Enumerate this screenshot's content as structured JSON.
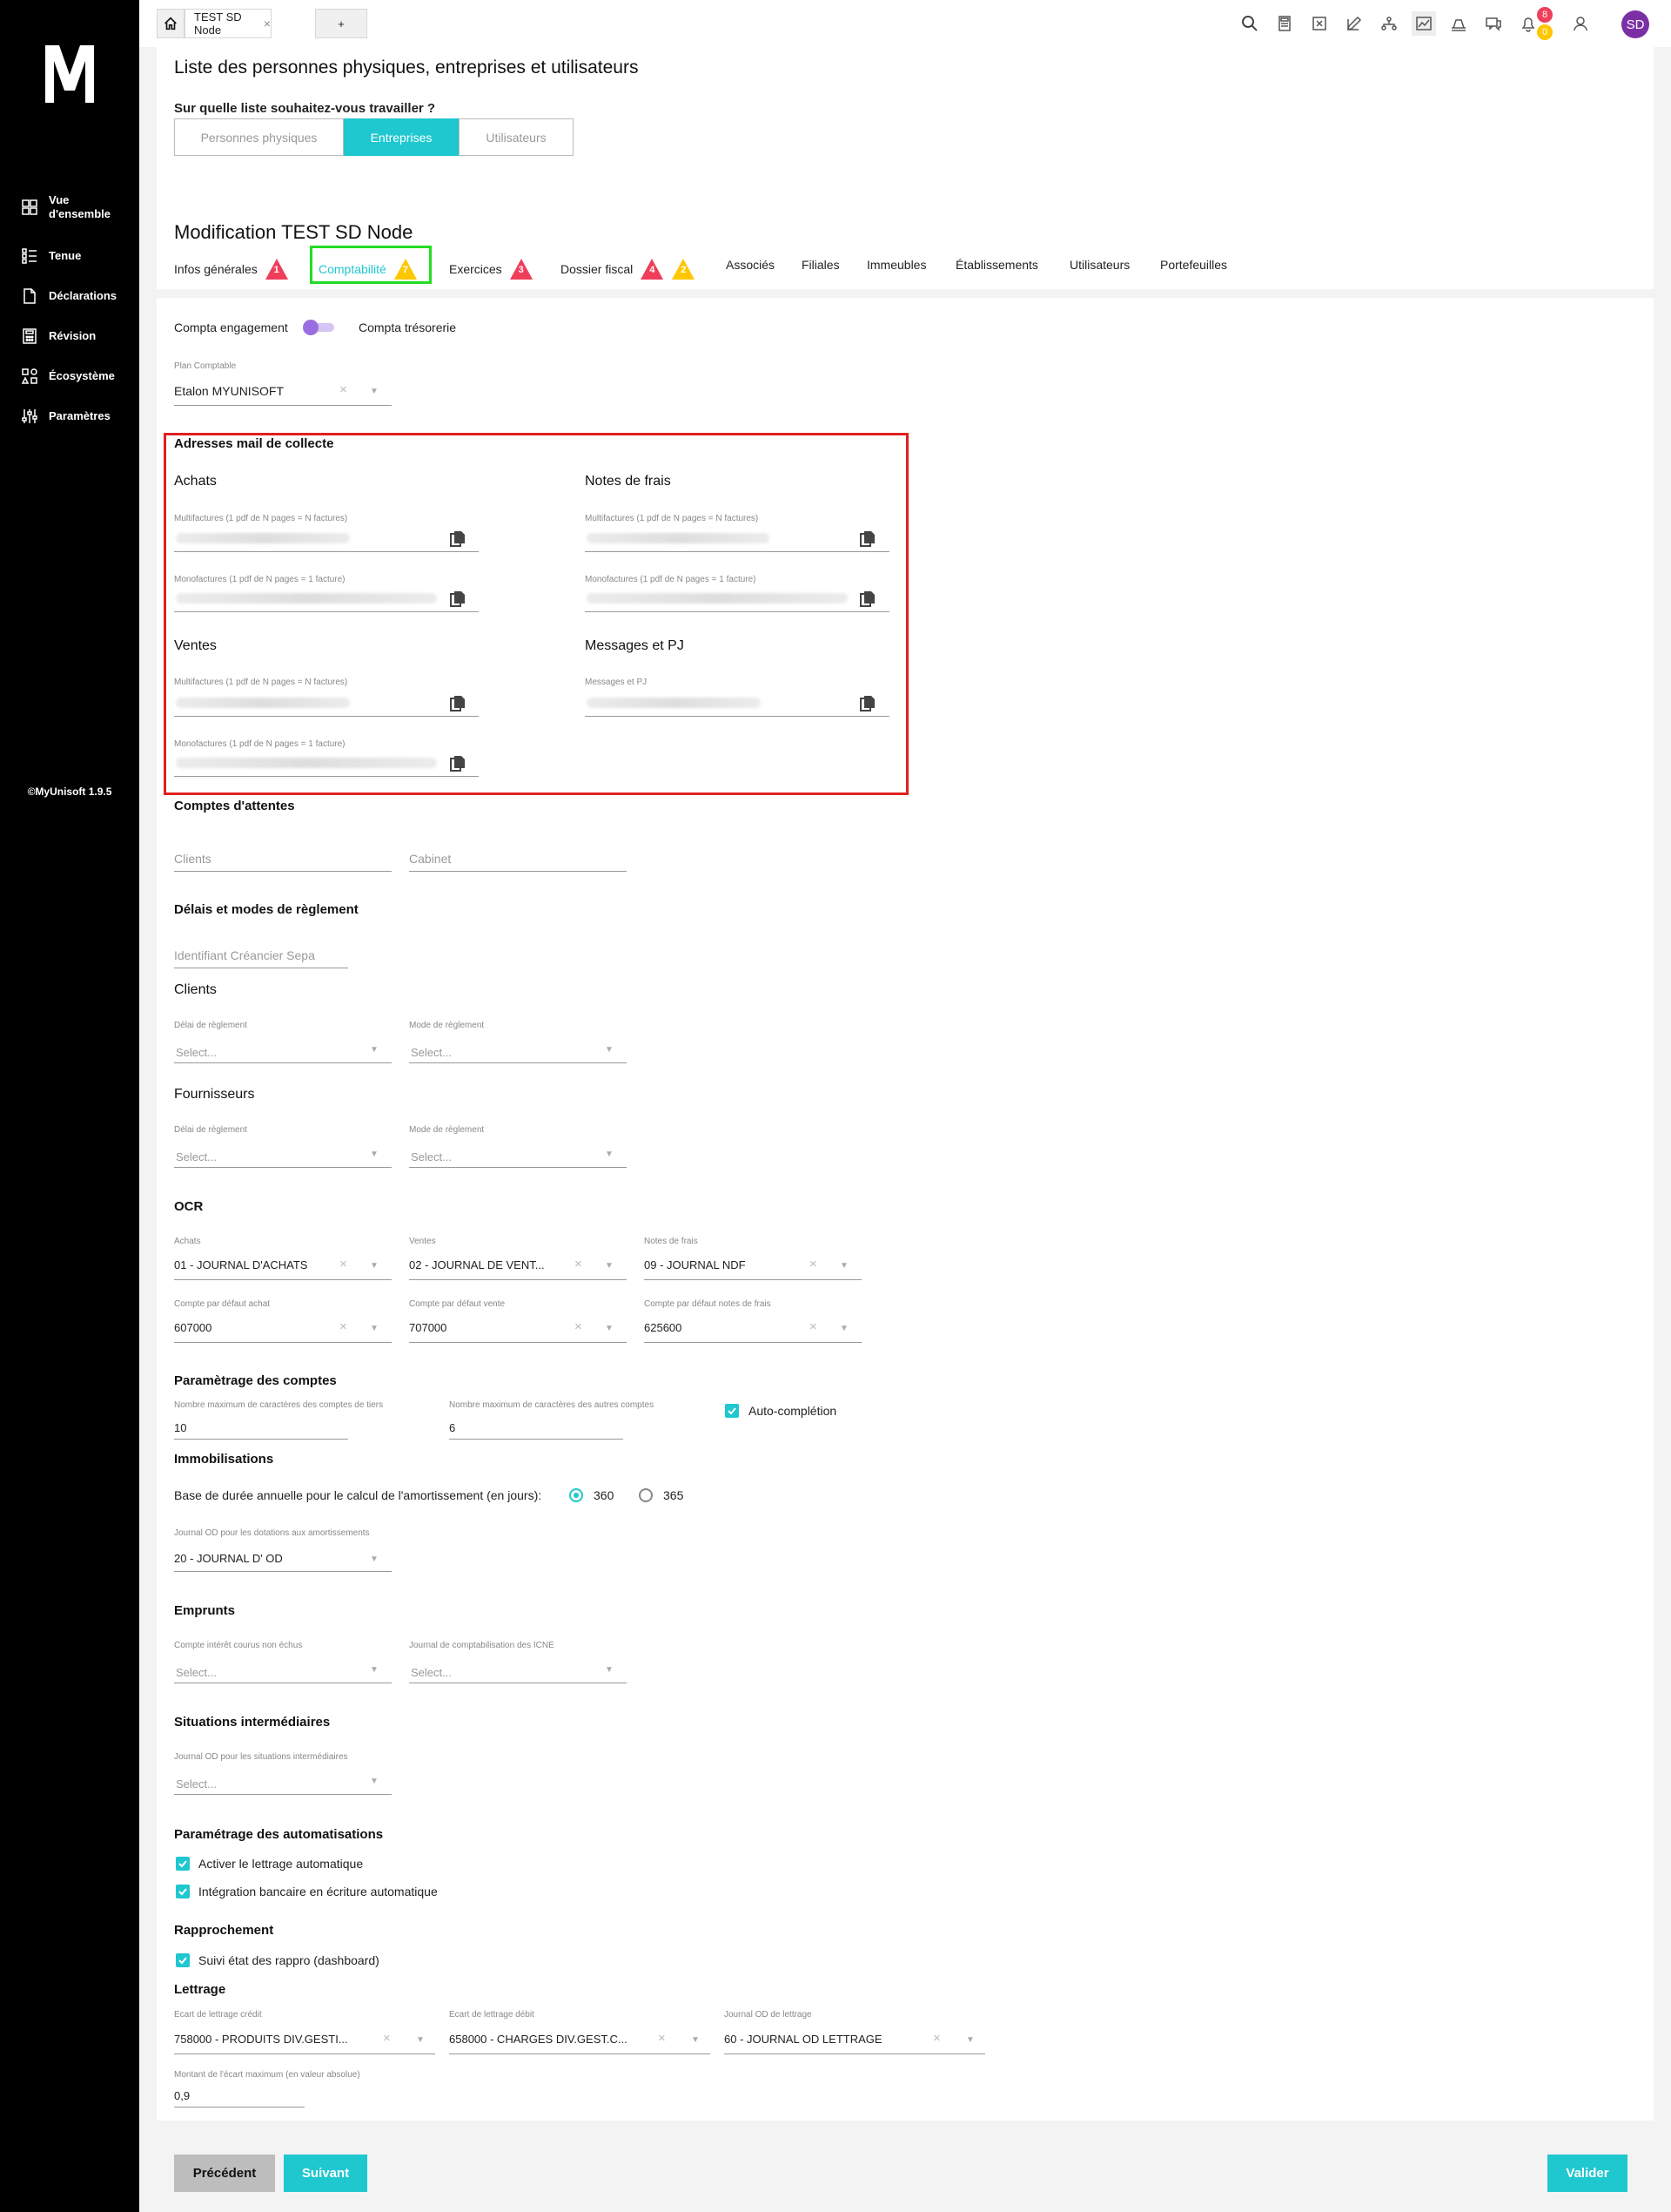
{
  "sidebar": {
    "logo": "M",
    "items": [
      {
        "label": "Vue\nd'ensemble",
        "icon": "grid-icon"
      },
      {
        "label": "Tenue",
        "icon": "list-icon"
      },
      {
        "label": "Déclarations",
        "icon": "document-icon"
      },
      {
        "label": "Révision",
        "icon": "calculator-icon"
      },
      {
        "label": "Écosystème",
        "icon": "ecosystem-icon"
      },
      {
        "label": "Paramètres",
        "icon": "sliders-icon"
      }
    ],
    "version": "©MyUnisoft 1.9.5"
  },
  "topbar": {
    "tab_label": "TEST SD Node",
    "add_tab": "+",
    "badges": {
      "notifications_red": "8",
      "notifications_yellow": "0"
    },
    "avatar": "SD"
  },
  "header": {
    "title": "Liste des personnes physiques, entreprises et utilisateurs",
    "question": "Sur quelle liste souhaitez-vous travailler ?",
    "segments": [
      "Personnes physiques",
      "Entreprises",
      "Utilisateurs"
    ],
    "active_segment": "Entreprises",
    "modification_title": "Modification TEST SD Node",
    "tabs": [
      {
        "label": "Infos générales",
        "badges": [
          {
            "color": "#ef3e5a",
            "count": "1"
          }
        ]
      },
      {
        "label": "Comptabilité",
        "badges": [
          {
            "color": "#ffc700",
            "count": "7"
          }
        ],
        "active": true
      },
      {
        "label": "Exercices",
        "badges": [
          {
            "color": "#ef3e5a",
            "count": "3"
          }
        ]
      },
      {
        "label": "Dossier fiscal",
        "badges": [
          {
            "color": "#ef3e5a",
            "count": "4"
          },
          {
            "color": "#ffc700",
            "count": "2"
          }
        ]
      },
      {
        "label": "Associés",
        "badges": []
      },
      {
        "label": "Filiales",
        "badges": []
      },
      {
        "label": "Immeubles",
        "badges": []
      },
      {
        "label": "Établissements",
        "badges": []
      },
      {
        "label": "Utilisateurs",
        "badges": []
      },
      {
        "label": "Portefeuilles",
        "badges": []
      }
    ]
  },
  "form": {
    "toggle_left": "Compta engagement",
    "toggle_right": "Compta trésorerie",
    "plan_label": "Plan Comptable",
    "plan_value": "Etalon MYUNISOFT",
    "mail_section": "Adresses mail de collecte",
    "achats": "Achats",
    "notes_de_frais": "Notes de frais",
    "ventes": "Ventes",
    "messages_pj": "Messages et PJ",
    "multi_label": "Multifactures (1 pdf de N pages = N factures)",
    "mono_label": "Monofactures (1 pdf de N pages = 1 facture)",
    "messages_label": "Messages et PJ",
    "comptes_attente": "Comptes d'attentes",
    "clients_ph": "Clients",
    "cabinet_ph": "Cabinet",
    "delais_title": "Délais et modes de règlement",
    "sepa_ph": "Identifiant Créancier Sepa",
    "clients_sub": "Clients",
    "fournisseurs_sub": "Fournisseurs",
    "delai_label": "Délai de règlement",
    "mode_label": "Mode de règlement",
    "select_ph": "Select...",
    "ocr_title": "OCR",
    "ocr_fields": [
      {
        "label": "Achats",
        "value": "01 - JOURNAL D'ACHATS"
      },
      {
        "label": "Ventes",
        "value": "02 - JOURNAL DE VENT..."
      },
      {
        "label": "Notes de frais",
        "value": "09 - JOURNAL NDF"
      },
      {
        "label": "Compte par défaut achat",
        "value": "607000"
      },
      {
        "label": "Compte par défaut vente",
        "value": "707000"
      },
      {
        "label": "Compte par défaut notes de frais",
        "value": "625600"
      }
    ],
    "param_comptes_title": "Paramètrage des comptes",
    "max_tiers_label": "Nombre maximum de caractères des comptes de tiers",
    "max_tiers_value": "10",
    "max_autres_label": "Nombre maximum de caractères des autres comptes",
    "max_autres_value": "6",
    "autocompletion": "Auto-complétion",
    "immo_title": "Immobilisations",
    "base_duree": "Base de durée annuelle pour le calcul de l'amortissement (en jours):",
    "opt_360": "360",
    "opt_365": "365",
    "journal_od_label": "Journal OD pour les dotations aux amortissements",
    "journal_od_value": "20 - JOURNAL D' OD",
    "emprunts_title": "Emprunts",
    "icne_compte_label": "Compte intérêt courus non échus",
    "icne_journal_label": "Journal de comptabilisation des ICNE",
    "situations_title": "Situations intermédiaires",
    "situations_label": "Journal OD pour les situations intermédiaires",
    "auto_title": "Paramétrage des automatisations",
    "auto_cb1": "Activer le lettrage automatique",
    "auto_cb2": "Intégration bancaire en écriture automatique",
    "rappro_title": "Rapprochement",
    "rappro_cb": "Suivi état des rappro (dashboard)",
    "lettrage_title": "Lettrage",
    "lettrage_fields": [
      {
        "label": "Ecart de lettrage crédit",
        "value": "758000 - PRODUITS DIV.GESTI..."
      },
      {
        "label": "Ecart de lettrage débit",
        "value": "658000 - CHARGES DIV.GEST.C..."
      },
      {
        "label": "Journal OD de lettrage",
        "value": "60 - JOURNAL OD LETTRAGE"
      }
    ],
    "montant_label": "Montant de l'écart maximum (en valeur absolue)",
    "montant_value": "0,9"
  },
  "footer": {
    "prev": "Précédent",
    "next": "Suivant",
    "validate": "Valider"
  },
  "colors": {
    "accent": "#1fc7cf",
    "red_badge": "#ef3e5a",
    "yellow_badge": "#ffc700",
    "avatar": "#7b2fa5"
  }
}
